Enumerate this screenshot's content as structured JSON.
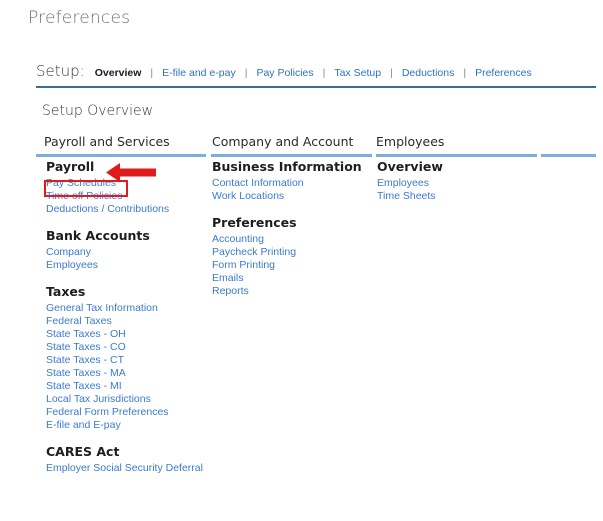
{
  "page": {
    "title": "Preferences",
    "section_title": "Setup Overview"
  },
  "setup_nav": {
    "label": "Setup:",
    "separator": "|",
    "items": [
      {
        "label": "Overview",
        "active": true
      },
      {
        "label": "E-file and e-pay",
        "active": false
      },
      {
        "label": "Pay Policies",
        "active": false
      },
      {
        "label": "Tax Setup",
        "active": false
      },
      {
        "label": "Deductions",
        "active": false
      },
      {
        "label": "Preferences",
        "active": false
      }
    ]
  },
  "columns": [
    {
      "header": "Payroll and Services",
      "groups": [
        {
          "title": "Payroll",
          "links": [
            "Pay Schedules",
            "Time off Policies",
            "Deductions / Contributions"
          ]
        },
        {
          "title": "Bank Accounts",
          "links": [
            "Company",
            "Employees"
          ]
        },
        {
          "title": "Taxes",
          "links": [
            "General Tax Information",
            "Federal Taxes",
            "State Taxes - OH",
            "State Taxes - CO",
            "State Taxes - CT",
            "State Taxes - MA",
            "State Taxes - MI",
            "Local Tax Jurisdictions",
            "Federal Form Preferences",
            "E-file and E-pay"
          ]
        },
        {
          "title": "CARES Act",
          "links": [
            "Employer Social Security Deferral"
          ]
        }
      ]
    },
    {
      "header": "Company and Account",
      "groups": [
        {
          "title": "Business Information",
          "links": [
            "Contact Information",
            "Work Locations"
          ]
        },
        {
          "title": "Preferences",
          "links": [
            "Accounting",
            "Paycheck Printing",
            "Form Printing",
            "Emails",
            "Reports"
          ]
        }
      ]
    },
    {
      "header": "Employees",
      "groups": [
        {
          "title": "Overview",
          "links": [
            "Employees",
            "Time Sheets"
          ]
        }
      ]
    },
    {
      "header": "",
      "groups": []
    }
  ],
  "annotations": {
    "highlight_target": "Pay Schedules",
    "arrow_target": "Payroll",
    "color": "#e01b1b"
  },
  "colors": {
    "link": "#3b7ad1",
    "nav_link": "#2e72c8",
    "rule": "#3c6e91",
    "column_rule": "#7eaede",
    "title": "#6e6e6e"
  }
}
